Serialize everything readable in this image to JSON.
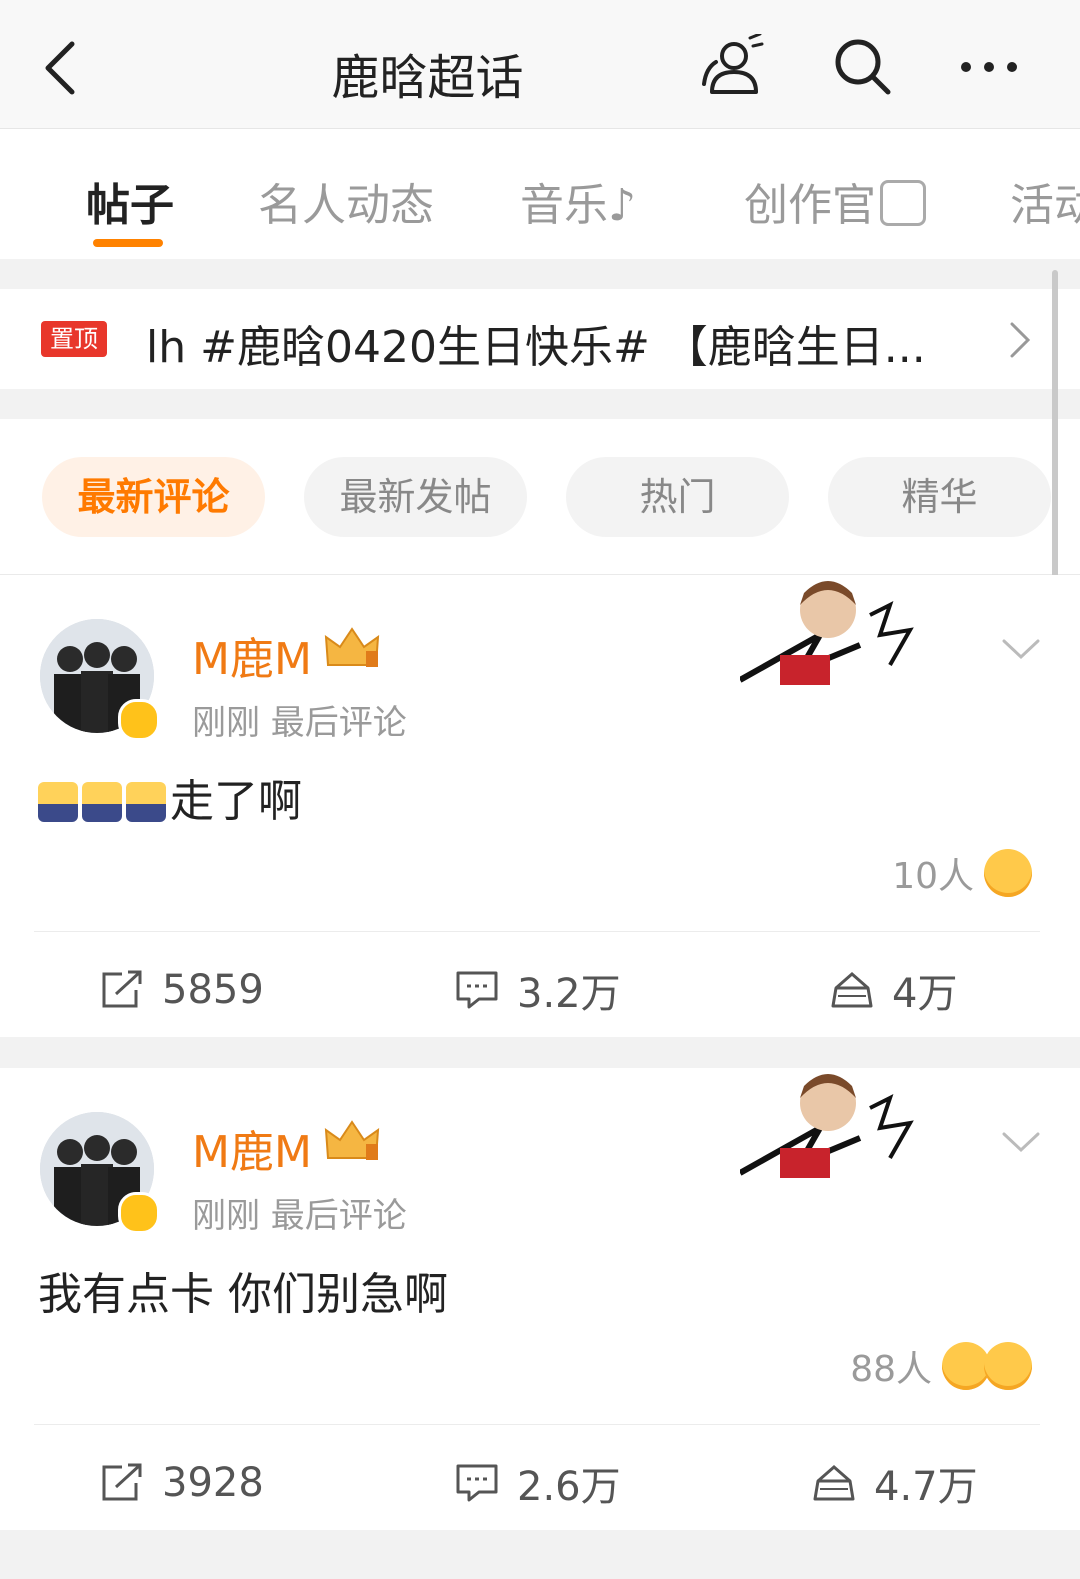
{
  "header": {
    "title": "鹿晗超话"
  },
  "tabs": [
    {
      "label": "帖子",
      "active": true
    },
    {
      "label": "名人动态"
    },
    {
      "label": "音乐♪"
    },
    {
      "label": "创作官"
    },
    {
      "label": "活动"
    }
  ],
  "pinned": {
    "badge": "置顶",
    "text": "lh #鹿晗0420生日快乐# 【鹿晗生日..."
  },
  "filters": [
    {
      "label": "最新评论",
      "active": true
    },
    {
      "label": "最新发帖"
    },
    {
      "label": "热门"
    },
    {
      "label": "精华"
    }
  ],
  "posts": [
    {
      "username": "M鹿M",
      "meta": "刚刚 最后评论",
      "content": "走了啊",
      "reaction_count": "10人",
      "repost": "5859",
      "comments": "3.2万",
      "likes": "4万"
    },
    {
      "username": "M鹿M",
      "meta": "刚刚 最后评论",
      "content": "我有点卡 你们别急啊",
      "reaction_count": "88人",
      "repost": "3928",
      "comments": "2.6万",
      "likes": "4.7万"
    }
  ],
  "colors": {
    "accent": "#ff8200",
    "username": "#f07a14",
    "pin_badge": "#e8372b",
    "verified": "#ffc21a"
  },
  "icons": [
    "back-arrow-icon",
    "people-icon",
    "search-icon",
    "more-icon",
    "chevron-right-icon",
    "chevron-down-icon",
    "repost-icon",
    "comment-icon",
    "like-icon"
  ]
}
